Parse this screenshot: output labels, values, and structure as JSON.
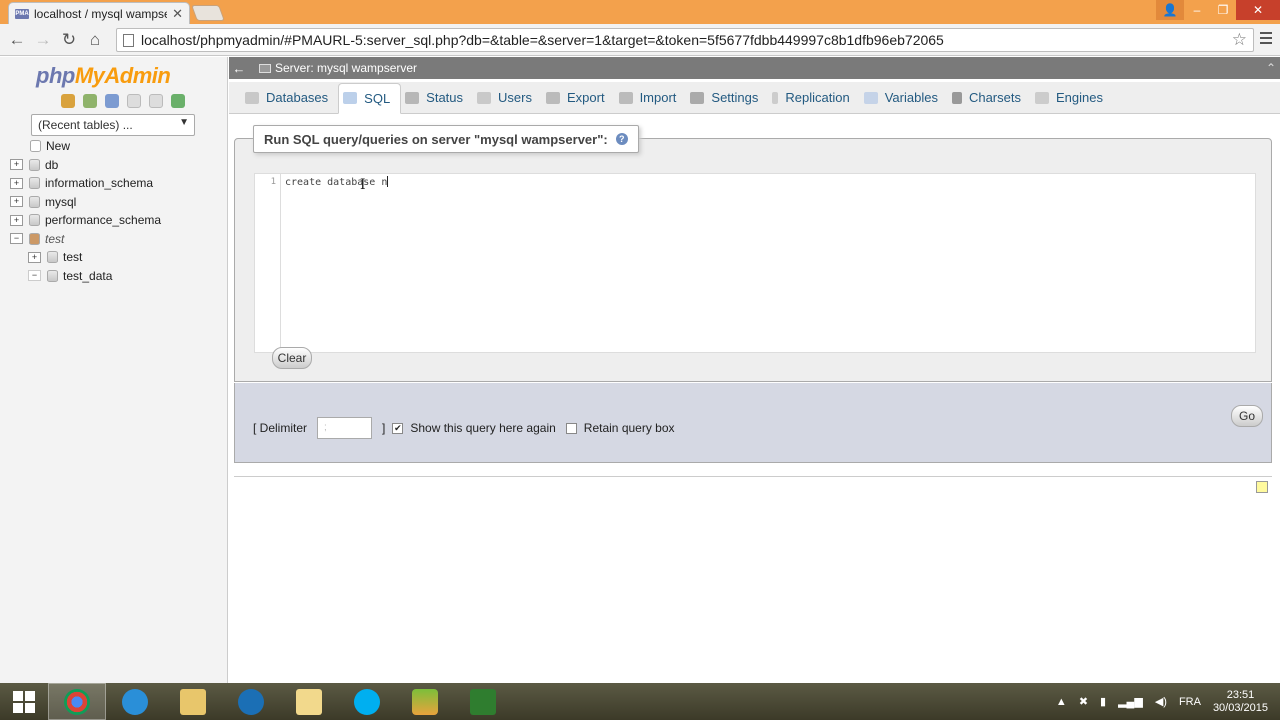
{
  "browser": {
    "tab_title": "localhost / mysql wampse",
    "tab_favicon": "PMA",
    "url": "localhost/phpmyadmin/#PMAURL-5:server_sql.php?db=&table=&server=1&target=&token=5f5677fdbb449997c8b1dfb96eb72065"
  },
  "sidebar": {
    "logo_php": "php",
    "logo_my": "MyAdmin",
    "recent_tables": "(Recent tables) ...",
    "tree": [
      {
        "label": "New",
        "italic": false
      },
      {
        "label": "db",
        "italic": false
      },
      {
        "label": "information_schema",
        "italic": false
      },
      {
        "label": "mysql",
        "italic": false
      },
      {
        "label": "performance_schema",
        "italic": false
      },
      {
        "label": "test",
        "italic": true
      },
      {
        "label": "test",
        "italic": false
      },
      {
        "label": "test_data",
        "italic": false
      }
    ]
  },
  "server_bar": {
    "label": "Server: mysql wampserver"
  },
  "tabs": [
    {
      "label": "Databases",
      "icon": "databases-icon",
      "active": false
    },
    {
      "label": "SQL",
      "icon": "sql-icon",
      "active": true
    },
    {
      "label": "Status",
      "icon": "status-icon",
      "active": false
    },
    {
      "label": "Users",
      "icon": "users-icon",
      "active": false
    },
    {
      "label": "Export",
      "icon": "export-icon",
      "active": false
    },
    {
      "label": "Import",
      "icon": "import-icon",
      "active": false
    },
    {
      "label": "Settings",
      "icon": "settings-icon",
      "active": false
    },
    {
      "label": "Replication",
      "icon": "replication-icon",
      "active": false
    },
    {
      "label": "Variables",
      "icon": "variables-icon",
      "active": false
    },
    {
      "label": "Charsets",
      "icon": "charsets-icon",
      "active": false
    },
    {
      "label": "Engines",
      "icon": "engines-icon",
      "active": false
    }
  ],
  "sql_panel": {
    "legend": "Run SQL query/queries on server \"mysql wampserver\":",
    "line_number": "1",
    "query": "create database n",
    "clear_label": "Clear"
  },
  "options": {
    "delimiter_label_open": "[ Delimiter",
    "delimiter_value": ";",
    "delimiter_label_close": "]",
    "show_query_label": "Show this query here again",
    "show_query_checked": true,
    "retain_label": "Retain query box",
    "retain_checked": false,
    "go_label": "Go"
  },
  "taskbar": {
    "language": "FRA",
    "time": "23:51",
    "date": "30/03/2015"
  },
  "colors": {
    "titlebar": "#f3a14c",
    "pma_blue": "#6c78af",
    "pma_orange": "#f89c0e",
    "link": "#235a81"
  }
}
